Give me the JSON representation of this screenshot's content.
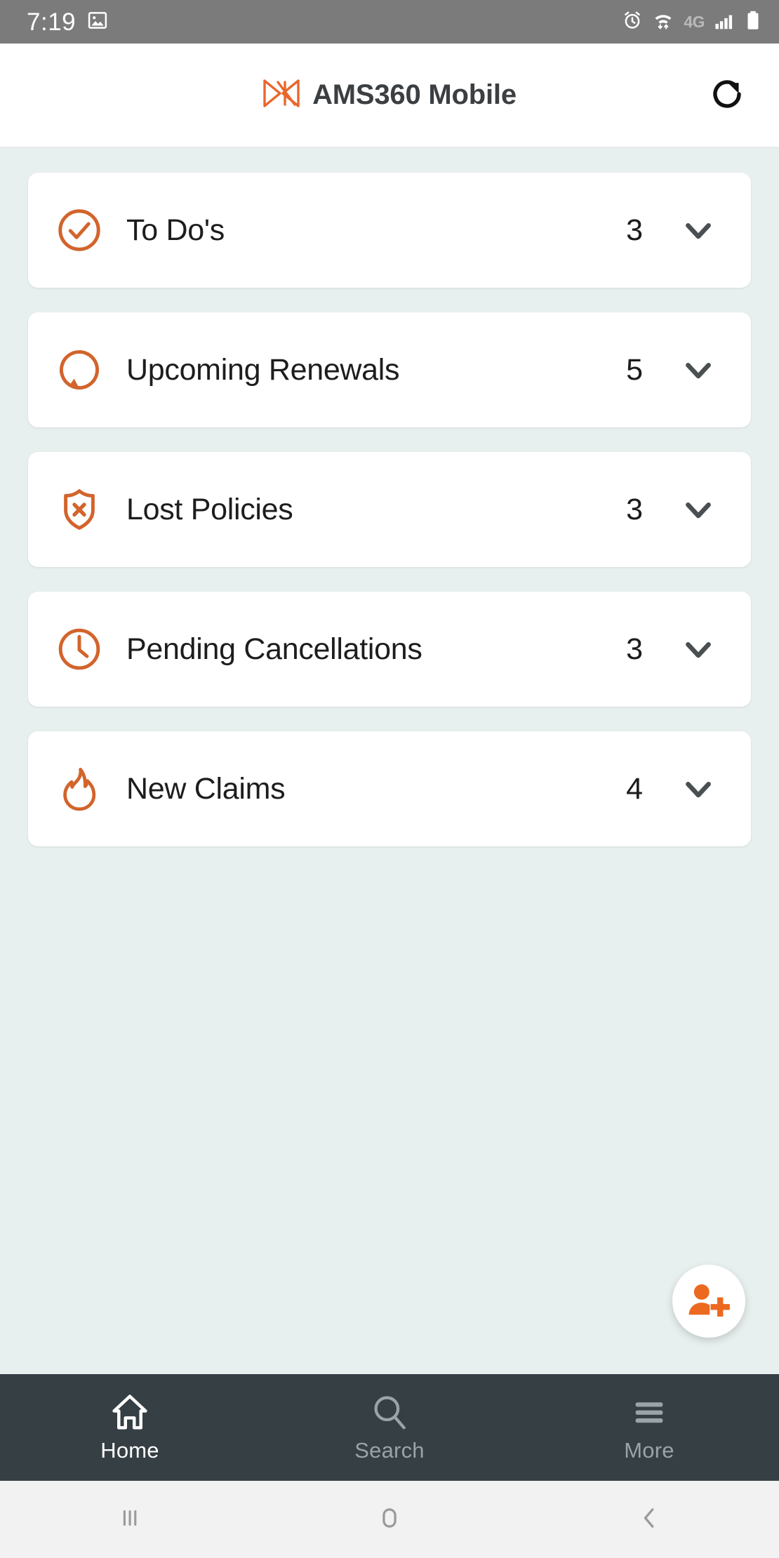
{
  "status_bar": {
    "time": "7:19",
    "icons": [
      "image-icon",
      "alarm-icon",
      "wifi-icon",
      "signal-icon",
      "battery-icon"
    ],
    "network_label": "4G",
    "background_color": "#7b7b7b",
    "text_color": "#ffffff"
  },
  "header": {
    "title": "AMS360 Mobile",
    "logo_name": "ams360-logo",
    "logo_color": "#e8682c",
    "title_color": "#3b3f42",
    "refresh_label": "refresh-icon",
    "background_color": "#ffffff"
  },
  "theme": {
    "accent": "#e8682c",
    "page_background": "#e8f0ef",
    "card_background": "#ffffff",
    "nav_background": "#353f44",
    "chevron_color": "#4a4f52"
  },
  "dashboard": {
    "cards": [
      {
        "label": "To Do's",
        "count": "3",
        "icon": "check-circle-icon"
      },
      {
        "label": "Upcoming Renewals",
        "count": "5",
        "icon": "refresh-cycle-icon"
      },
      {
        "label": "Lost Policies",
        "count": "3",
        "icon": "shield-x-icon"
      },
      {
        "label": "Pending Cancellations",
        "count": "3",
        "icon": "clock-icon"
      },
      {
        "label": "New Claims",
        "count": "4",
        "icon": "flame-icon"
      }
    ]
  },
  "fab": {
    "name": "add-contact-button",
    "icon": "person-plus-icon",
    "color": "#e8682c"
  },
  "bottom_nav": {
    "items": [
      {
        "label": "Home",
        "icon": "home-icon",
        "active": true
      },
      {
        "label": "Search",
        "icon": "search-icon",
        "active": false
      },
      {
        "label": "More",
        "icon": "hamburger-icon",
        "active": false
      }
    ]
  },
  "system_nav": {
    "recents_label": "recents-icon",
    "home_label": "home-square-icon",
    "back_label": "back-chevron-icon"
  }
}
